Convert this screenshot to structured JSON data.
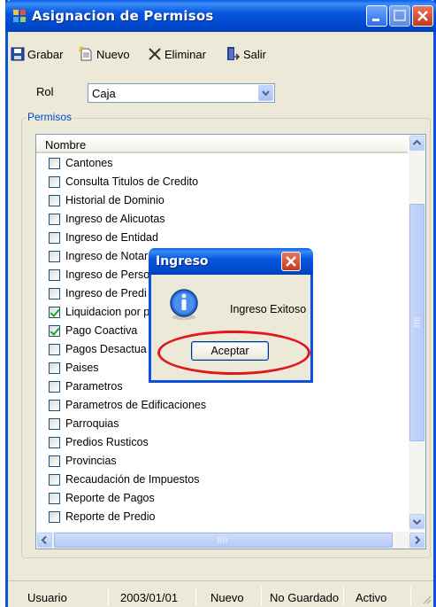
{
  "window": {
    "title": "Asignacion de Permisos",
    "icons": {
      "app": "app-icon",
      "minimize": "minimize-icon",
      "maximize": "maximize-icon",
      "close": "close-icon"
    }
  },
  "toolbar": {
    "grabar": "Grabar",
    "nuevo": "Nuevo",
    "eliminar": "Eliminar",
    "salir": "Salir"
  },
  "rol": {
    "label": "Rol",
    "value": "Caja"
  },
  "permisos": {
    "title": "Permisos",
    "column_header": "Nombre",
    "items": [
      {
        "label": "Cantones",
        "checked": false
      },
      {
        "label": "Consulta Titulos de Credito",
        "checked": false
      },
      {
        "label": "Historial de Dominio",
        "checked": false
      },
      {
        "label": "Ingreso de Alicuotas",
        "checked": false
      },
      {
        "label": "Ingreso de Entidad",
        "checked": false
      },
      {
        "label": "Ingreso de Notar",
        "checked": false
      },
      {
        "label": "Ingreso de Perso",
        "checked": false
      },
      {
        "label": "Ingreso de Predi",
        "checked": false
      },
      {
        "label": "Liquidacion por p",
        "checked": true
      },
      {
        "label": "Pago Coactiva",
        "checked": true
      },
      {
        "label": "Pagos Desactua",
        "checked": false
      },
      {
        "label": "Paises",
        "checked": false
      },
      {
        "label": "Parametros",
        "checked": false
      },
      {
        "label": "Parametros de Edificaciones",
        "checked": false
      },
      {
        "label": "Parroquias",
        "checked": false
      },
      {
        "label": "Predios Rusticos",
        "checked": false
      },
      {
        "label": "Provincias",
        "checked": false
      },
      {
        "label": "Recaudación de Impuestos",
        "checked": false
      },
      {
        "label": "Reporte de Pagos",
        "checked": false
      },
      {
        "label": "Reporte de Predio",
        "checked": false
      }
    ]
  },
  "statusbar": {
    "usuario": "Usuario",
    "fecha": "2003/01/01",
    "modo": "Nuevo",
    "guardado": "No Guardado",
    "estado": "Activo"
  },
  "dialog": {
    "title": "Ingreso",
    "message": "Ingreso Exitoso",
    "button": "Aceptar"
  },
  "colors": {
    "titlebar": "#0a53d9",
    "close": "#c4391c",
    "highlight": "#e0181b"
  }
}
